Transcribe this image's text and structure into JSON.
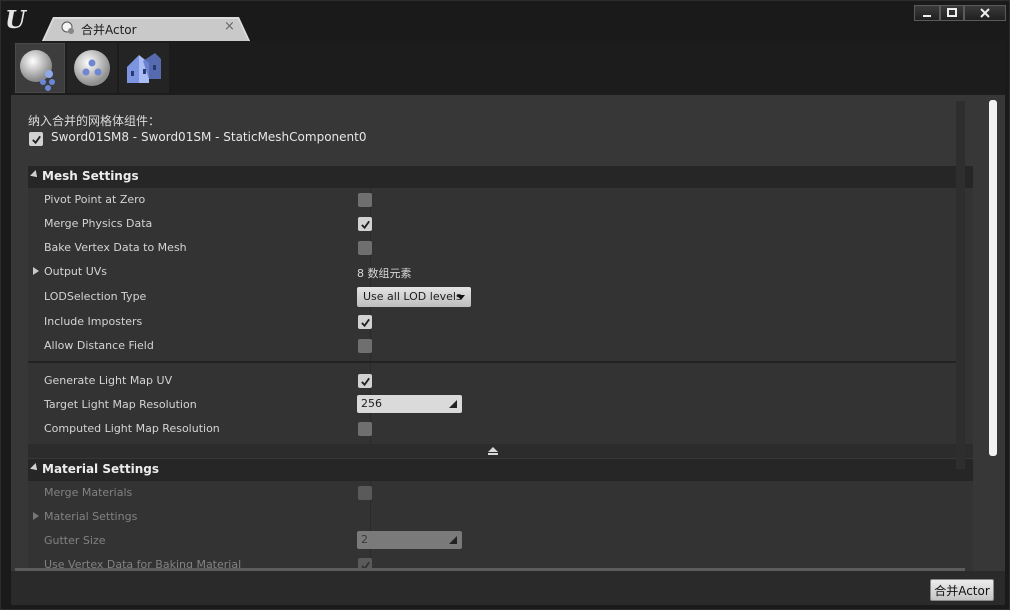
{
  "window": {
    "tab_title": "合并Actor",
    "tab_close": "×",
    "minimize": "▁",
    "maximize": "□",
    "close": "✕"
  },
  "toolbar": {
    "tools": [
      {
        "icon": "merge-actor-icon",
        "active": true
      },
      {
        "icon": "proxy-mesh-icon",
        "active": false
      },
      {
        "icon": "instance-building-icon",
        "active": false
      }
    ]
  },
  "panel": {
    "include_label": "纳入合并的网格体组件：",
    "component": {
      "label": "Sword01SM8 - Sword01SM - StaticMeshComponent0",
      "checked": true
    }
  },
  "mesh_settings": {
    "title": "Mesh Settings",
    "rows": [
      {
        "label": "Pivot Point at Zero",
        "type": "checkbox",
        "checked": false
      },
      {
        "label": "Merge Physics Data",
        "type": "checkbox",
        "checked": true
      },
      {
        "label": "Bake Vertex Data to Mesh",
        "type": "checkbox",
        "checked": false
      },
      {
        "label": "Output UVs",
        "type": "text",
        "value": "8 数组元素",
        "expandable": true
      },
      {
        "label": "LODSelection Type",
        "type": "combo",
        "value": "Use all LOD levels"
      },
      {
        "label": "Include Imposters",
        "type": "checkbox",
        "checked": true
      },
      {
        "label": "Allow Distance Field",
        "type": "checkbox",
        "checked": false
      }
    ],
    "advanced_rows": [
      {
        "label": "Generate Light Map UV",
        "type": "checkbox",
        "checked": true
      },
      {
        "label": "Target Light Map Resolution",
        "type": "number",
        "value": "256"
      },
      {
        "label": "Computed Light Map Resolution",
        "type": "checkbox",
        "checked": false
      }
    ]
  },
  "material_settings": {
    "title": "Material Settings",
    "rows": [
      {
        "label": "Merge Materials",
        "type": "checkbox",
        "checked": false
      },
      {
        "label": "Material Settings",
        "type": "expander"
      },
      {
        "label": "Gutter Size",
        "type": "number",
        "value": "2"
      },
      {
        "label": "Use Vertex Data for Baking Material",
        "type": "checkbox",
        "checked": true
      }
    ]
  },
  "footer": {
    "merge_button": "合并Actor"
  },
  "colors": {
    "background": "#1a1a1a",
    "panel": "#373737",
    "category_header": "#262626",
    "text": "#d4d4d4",
    "button": "#d8d8d8"
  }
}
